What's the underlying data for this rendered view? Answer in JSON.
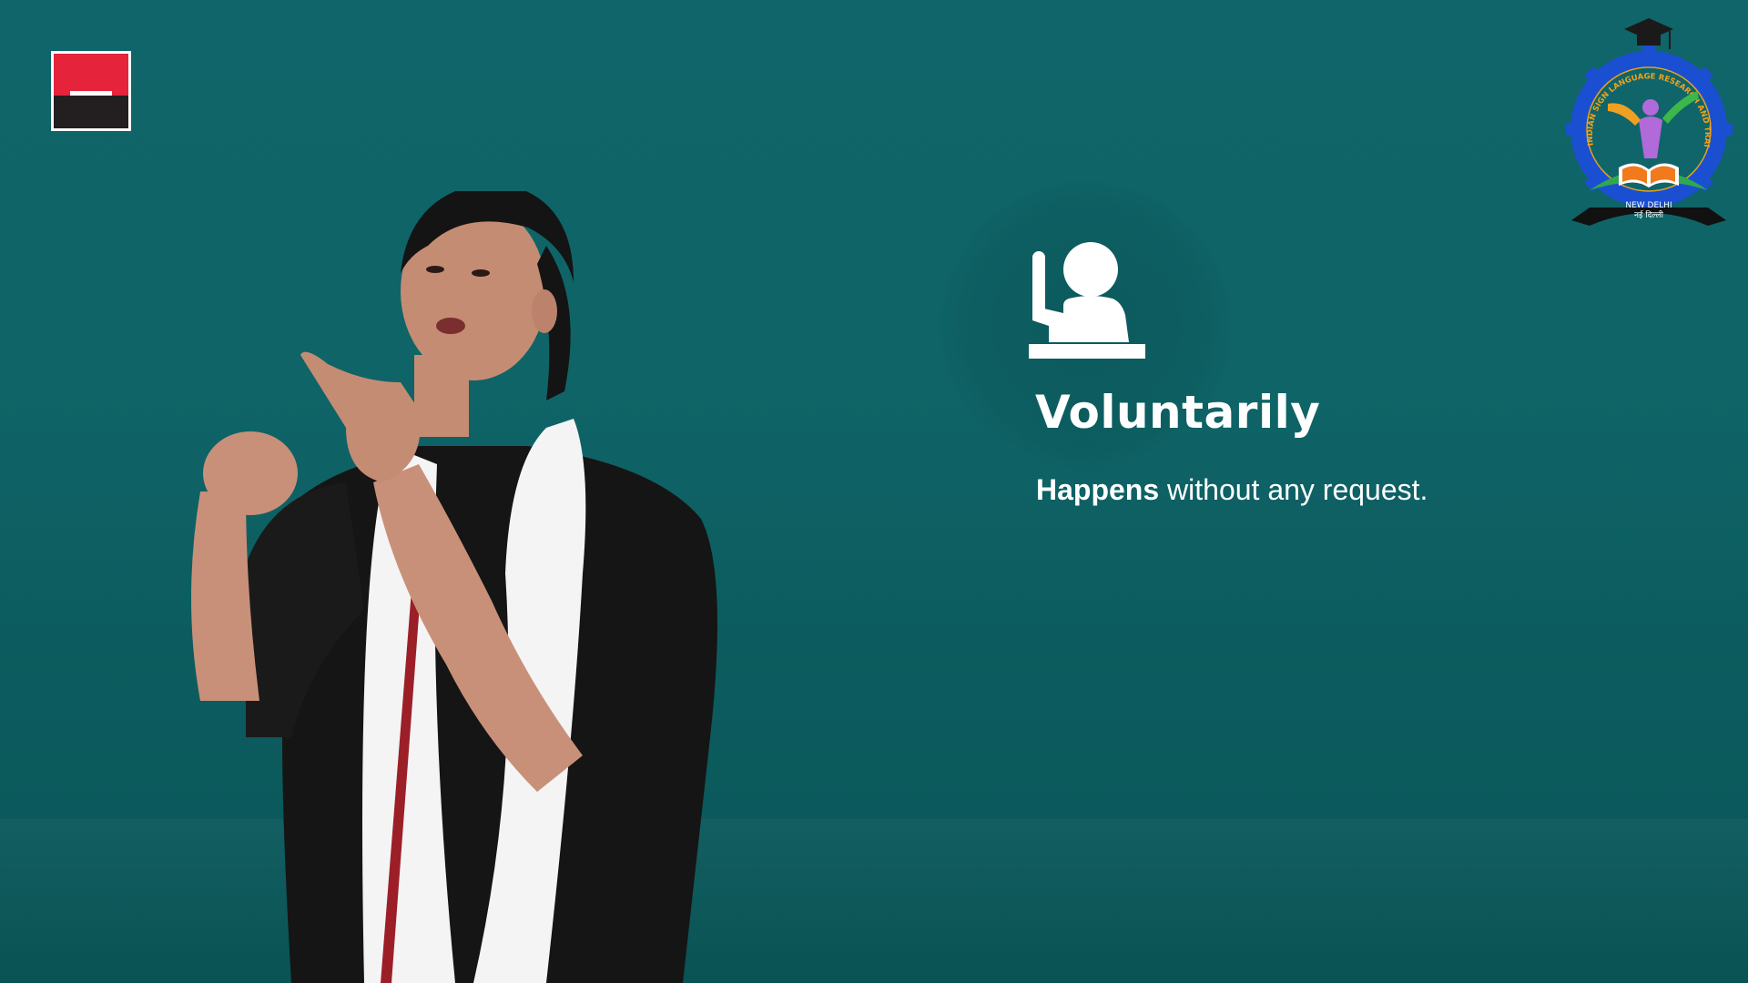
{
  "slide": {
    "headline": "Voluntarily",
    "description_bold": "Happens",
    "description_rest": " without any request."
  },
  "emblem": {
    "ring_text": "INDIAN SIGN LANGUAGE RESEARCH AND TRAINING CENTRE",
    "city_en": "NEW DELHI",
    "city_hi": "नई दिल्ली"
  },
  "icons": {
    "brand": "brand-logo-icon",
    "volunteer": "raised-hand-person-icon",
    "emblem": "isl-emblem-icon"
  },
  "colors": {
    "background": "#0f6569",
    "brand_red": "#e5233a",
    "brand_black": "#231f20",
    "text": "#ffffff"
  }
}
